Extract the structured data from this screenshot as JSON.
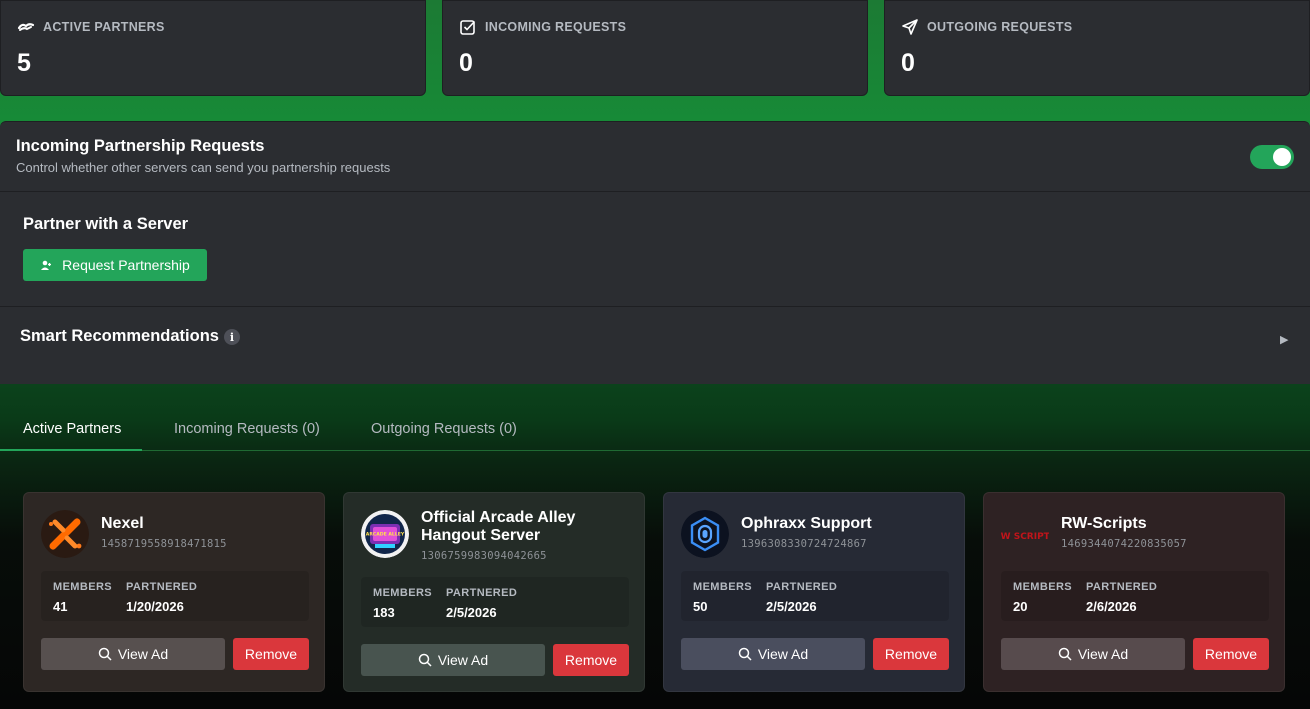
{
  "stats": [
    {
      "icon": "handshake-icon",
      "label": "ACTIVE PARTNERS",
      "value": "5"
    },
    {
      "icon": "checkbox-icon",
      "label": "INCOMING REQUESTS",
      "value": "0"
    },
    {
      "icon": "send-icon",
      "label": "OUTGOING REQUESTS",
      "value": "0"
    }
  ],
  "incoming_toggle": {
    "title": "Incoming Partnership Requests",
    "subtitle": "Control whether other servers can send you partnership requests",
    "enabled": true
  },
  "partner_section": {
    "title": "Partner with a Server",
    "button_label": "Request Partnership"
  },
  "smart": {
    "title": "Smart Recommendations",
    "info_glyph": "i",
    "expand_glyph": "▶"
  },
  "tabs": [
    {
      "label": "Active Partners",
      "active": true
    },
    {
      "label": "Incoming Requests (0)",
      "active": false
    },
    {
      "label": "Outgoing Requests (0)",
      "active": false
    }
  ],
  "labels": {
    "members": "MEMBERS",
    "partnered": "PARTNERED",
    "view_ad": "View Ad",
    "remove": "Remove"
  },
  "partners": [
    {
      "name": "Nexel",
      "id": "1458719558918471815",
      "members": "41",
      "partnered": "1/20/2026",
      "avatar": "nexel-logo"
    },
    {
      "name": "Official Arcade Alley Hangout Server",
      "id": "1306759983094042665",
      "members": "183",
      "partnered": "2/5/2026",
      "avatar": "arcade-alley-logo",
      "avatar_text": "ARCADE ALLEY"
    },
    {
      "name": "Ophraxx Support",
      "id": "1396308330724724867",
      "members": "50",
      "partnered": "2/5/2026",
      "avatar": "ophraxx-logo"
    },
    {
      "name": "RW-Scripts",
      "id": "1469344074220835057",
      "members": "20",
      "partnered": "2/6/2026",
      "avatar": "rw-scripts-logo",
      "avatar_text": "RW SCRIPTS"
    }
  ],
  "colors": {
    "accent_green": "#23a55a",
    "danger_red": "#da373c",
    "panel_bg": "#2b2d31"
  }
}
